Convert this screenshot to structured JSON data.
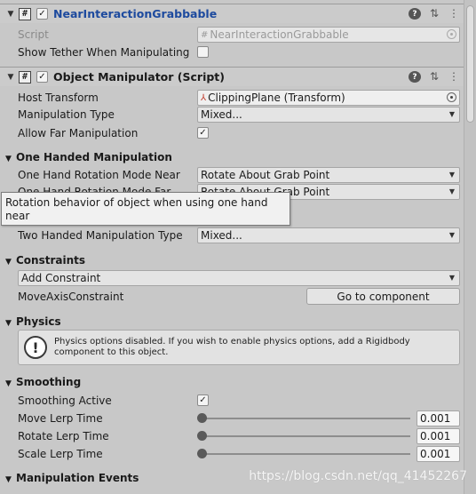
{
  "component1": {
    "title": "NearInteractionGrabbable",
    "enabled_check": "✓",
    "script_label": "Script",
    "script_value": "NearInteractionGrabbable",
    "show_tether_label": "Show Tether When Manipulating"
  },
  "component2": {
    "title": "Object Manipulator (Script)",
    "enabled_check": "✓",
    "host_transform_label": "Host Transform",
    "host_transform_value": "ClippingPlane (Transform)",
    "manipulation_type_label": "Manipulation Type",
    "manipulation_type_value": "Mixed...",
    "allow_far_label": "Allow Far Manipulation",
    "allow_far_check": "✓",
    "one_handed_section": "One Handed Manipulation",
    "one_hand_near_label": "One Hand Rotation Mode Near",
    "one_hand_near_value": "Rotate About Grab Point",
    "one_hand_far_label": "One Hand Rotation Mode Far",
    "one_hand_far_value": "Rotate About Grab Point",
    "two_handed_type_label": "Two Handed Manipulation Type",
    "two_handed_type_value": "Mixed...",
    "constraints_section": "Constraints",
    "add_constraint": "Add Constraint",
    "move_axis_label": "MoveAxisConstraint",
    "go_to_component": "Go to component",
    "physics_section": "Physics",
    "physics_help": "Physics options disabled. If you wish to enable physics options, add a Rigidbody component to this object.",
    "smoothing_section": "Smoothing",
    "smoothing_active_label": "Smoothing Active",
    "smoothing_active_check": "✓",
    "move_lerp_label": "Move Lerp Time",
    "move_lerp_value": "0.001",
    "rotate_lerp_label": "Rotate Lerp Time",
    "rotate_lerp_value": "0.001",
    "scale_lerp_label": "Scale Lerp Time",
    "scale_lerp_value": "0.001",
    "events_section": "Manipulation Events"
  },
  "tooltip": "Rotation behavior of object when using one hand near",
  "watermark": "https://blog.csdn.net/qq_41452267",
  "colors": {
    "panel_bg": "#c8c8c8",
    "header_bg": "#cbcbcb",
    "title_blue": "#1d4a9e"
  }
}
